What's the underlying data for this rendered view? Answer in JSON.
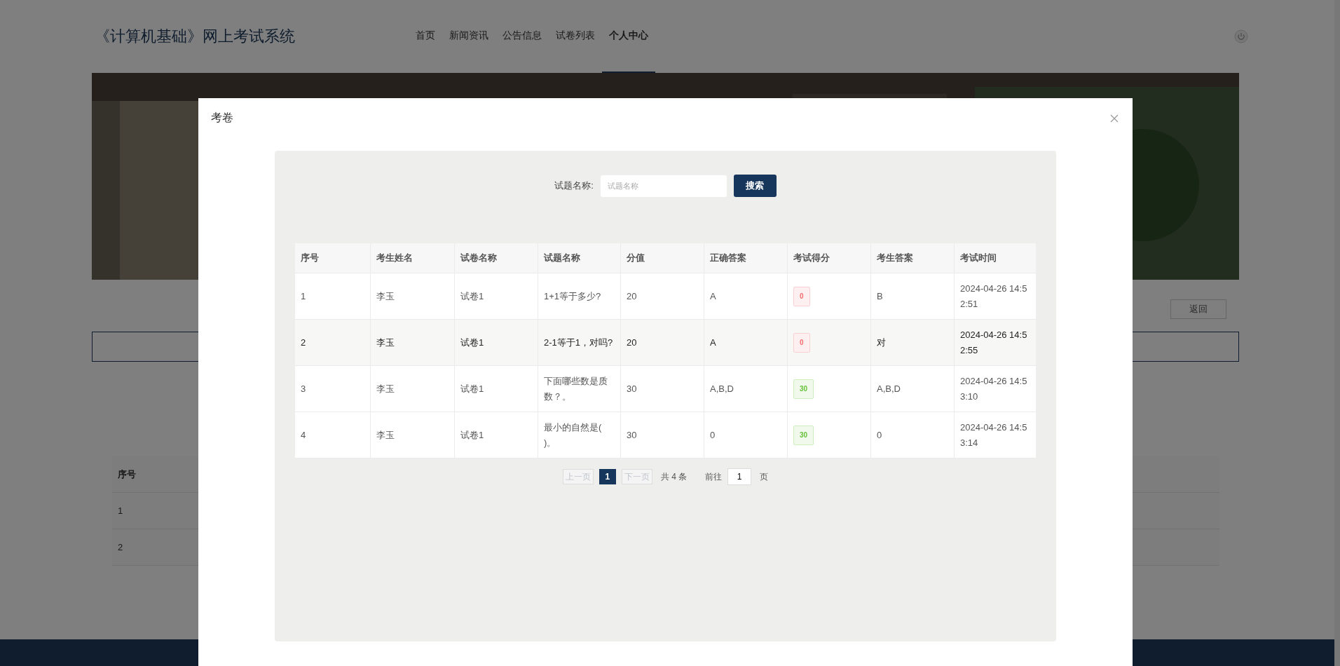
{
  "header": {
    "title": "《计算机基础》网上考试系统",
    "nav": [
      {
        "label": "首页",
        "selected": false
      },
      {
        "label": "新闻资讯",
        "selected": false
      },
      {
        "label": "公告信息",
        "selected": false
      },
      {
        "label": "试卷列表",
        "selected": false
      },
      {
        "label": "个人中心",
        "selected": true
      }
    ]
  },
  "back_button": "返回",
  "background_table": {
    "columns": [
      "序号"
    ],
    "rows": [
      "1",
      "2"
    ]
  },
  "dialog": {
    "title": "考卷",
    "search": {
      "label": "试题名称:",
      "placeholder": "试题名称",
      "button": "搜索"
    },
    "table": {
      "columns": [
        "序号",
        "考生姓名",
        "试卷名称",
        "试题名称",
        "分值",
        "正确答案",
        "考试得分",
        "考生答案",
        "考试时间"
      ],
      "rows": [
        {
          "highlighted": false,
          "cells": [
            "1",
            "李玉",
            "试卷1",
            "1+1等于多少?",
            "20",
            "A"
          ],
          "score": {
            "text": "0",
            "kind": "fail"
          },
          "answer": "B",
          "time": "2024-04-26 14:52:51"
        },
        {
          "highlighted": true,
          "cells": [
            "2",
            "李玉",
            "试卷1",
            "2-1等于1，对吗?",
            "20",
            "A"
          ],
          "score": {
            "text": "0",
            "kind": "fail"
          },
          "answer": "对",
          "time": "2024-04-26 14:52:55"
        },
        {
          "highlighted": false,
          "cells": [
            "3",
            "李玉",
            "试卷1",
            "下面哪些数是质数？。",
            "30",
            "A,B,D"
          ],
          "score": {
            "text": "30",
            "kind": "pass"
          },
          "answer": "A,B,D",
          "time": "2024-04-26 14:53:10"
        },
        {
          "highlighted": false,
          "cells": [
            "4",
            "李玉",
            "试卷1",
            "最小的自然是(  )。",
            "30",
            "0"
          ],
          "score": {
            "text": "30",
            "kind": "pass"
          },
          "answer": "0",
          "time": "2024-04-26 14:53:14"
        }
      ]
    },
    "pagination": {
      "prev": {
        "label": "上一页",
        "disabled": true
      },
      "pages": [
        {
          "label": "1",
          "selected": true
        }
      ],
      "next": {
        "label": "下一页",
        "disabled": true
      },
      "total": "共 4 条",
      "goto_label": "前往",
      "goto_value": "1",
      "goto_suffix": "页"
    }
  }
}
